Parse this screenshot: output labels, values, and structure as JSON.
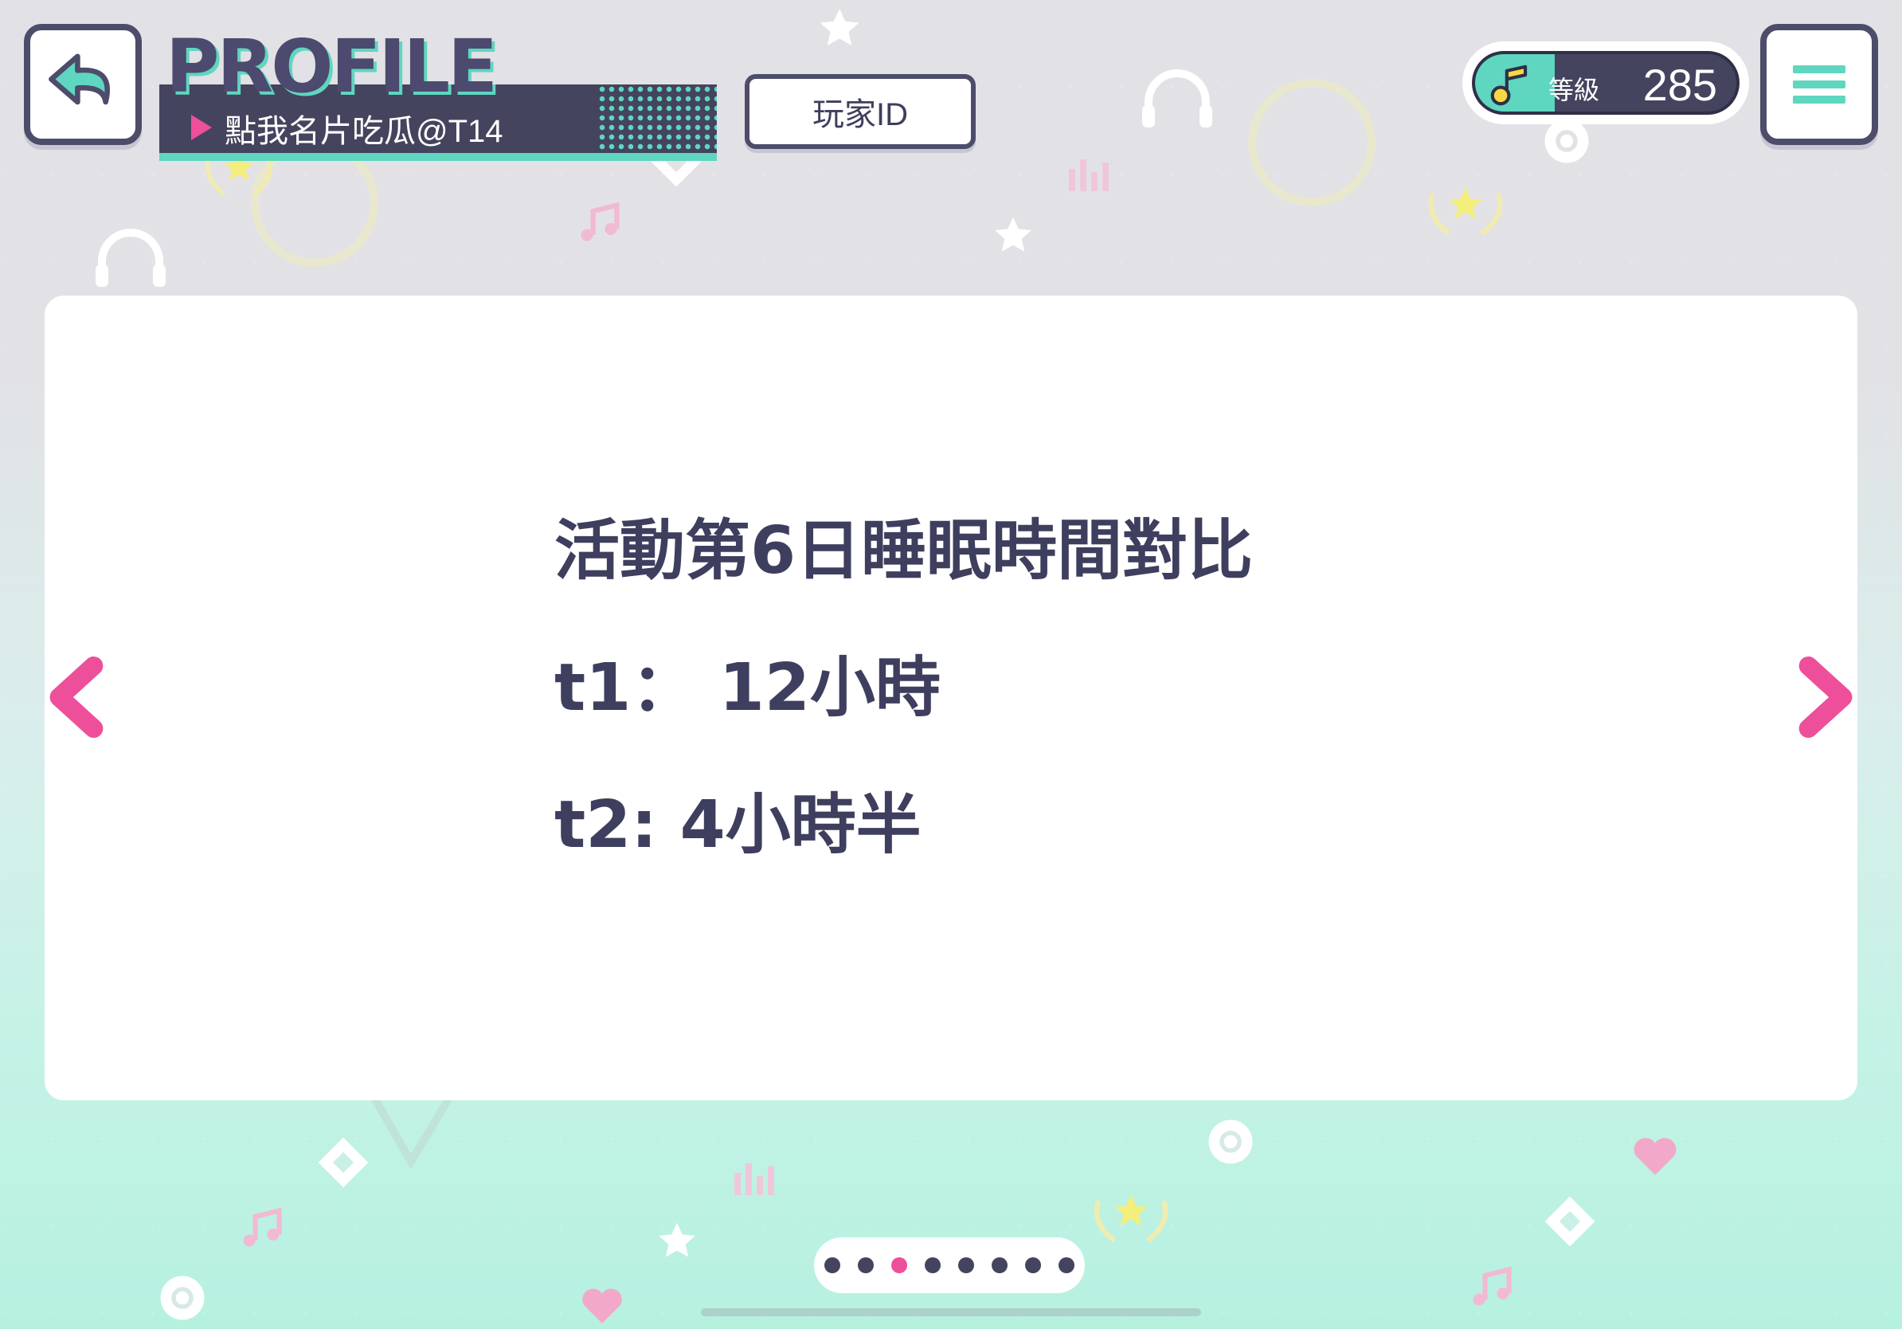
{
  "header": {
    "title": "PROFILE",
    "card_name": "點我名片吃瓜@T14",
    "player_id_label": "玩家ID"
  },
  "level": {
    "label": "等級",
    "value": "285"
  },
  "card": {
    "line1": "活動第6日睡眠時間對比",
    "line2": "t1：  12小時",
    "line3": "t2:  4小時半"
  },
  "pager": {
    "total": 8,
    "active_index": 2
  },
  "colors": {
    "accent_pink": "#ee4f9a",
    "accent_teal": "#5fd6c0",
    "navy": "#44445f"
  }
}
